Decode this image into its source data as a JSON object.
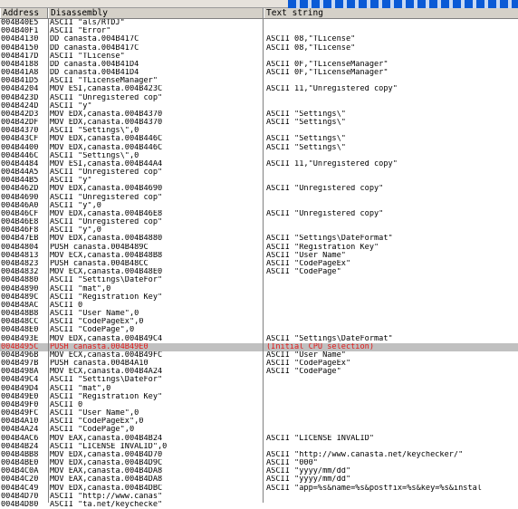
{
  "columns": {
    "address": "Address",
    "disassembly": "Disassembly",
    "text": "Text string"
  },
  "rows": [
    {
      "address": "004B40E5",
      "disasm": "ASCII \"als/RTDJ\"",
      "text": ""
    },
    {
      "address": "004B40F1",
      "disasm": "ASCII \"Error\"",
      "text": ""
    },
    {
      "address": "004B4130",
      "disasm": "DD canasta.004B417C",
      "text": "ASCII 08,\"TLicense\""
    },
    {
      "address": "004B4150",
      "disasm": "DD canasta.004B417C",
      "text": "ASCII 08,\"TLicense\""
    },
    {
      "address": "004B417D",
      "disasm": "ASCII \"TLicense\"",
      "text": ""
    },
    {
      "address": "004B4188",
      "disasm": "DD canasta.004B41D4",
      "text": "ASCII 0F,\"TLicenseManager\""
    },
    {
      "address": "004B41A8",
      "disasm": "DD canasta.004B41D4",
      "text": "ASCII 0F,\"TLicenseManager\""
    },
    {
      "address": "004B41D5",
      "disasm": "ASCII \"TLicenseManager\"",
      "text": ""
    },
    {
      "address": "004B4204",
      "disasm": "MOV ESI,canasta.004B423C",
      "text": "ASCII 11,\"Unregistered copy\""
    },
    {
      "address": "004B423D",
      "disasm": "ASCII \"Unregistered cop\"",
      "text": ""
    },
    {
      "address": "004B424D",
      "disasm": "ASCII \"y\"",
      "text": ""
    },
    {
      "address": "004B42D3",
      "disasm": "MOV EDX,canasta.004B4370",
      "text": "ASCII \"Settings\\\""
    },
    {
      "address": "004B42DF",
      "disasm": "MOV EDX,canasta.004B4370",
      "text": "ASCII \"Settings\\\""
    },
    {
      "address": "004B4370",
      "disasm": "ASCII \"Settings\\\",0",
      "text": ""
    },
    {
      "address": "004B43CF",
      "disasm": "MOV EDX,canasta.004B446C",
      "text": "ASCII \"Settings\\\""
    },
    {
      "address": "004B4400",
      "disasm": "MOV EDX,canasta.004B446C",
      "text": "ASCII \"Settings\\\""
    },
    {
      "address": "004B446C",
      "disasm": "ASCII \"Settings\\\",0",
      "text": ""
    },
    {
      "address": "004B4484",
      "disasm": "MOV ESI,canasta.004B44A4",
      "text": "ASCII 11,\"Unregistered copy\""
    },
    {
      "address": "004B44A5",
      "disasm": "ASCII \"Unregistered cop\"",
      "text": ""
    },
    {
      "address": "004B44B5",
      "disasm": "ASCII \"y\"",
      "text": ""
    },
    {
      "address": "004B462D",
      "disasm": "MOV EDX,canasta.004B4690",
      "text": "ASCII \"Unregistered copy\""
    },
    {
      "address": "004B4690",
      "disasm": "ASCII \"Unregistered cop\"",
      "text": ""
    },
    {
      "address": "004B46A0",
      "disasm": "ASCII \"y\",0",
      "text": ""
    },
    {
      "address": "004B46CF",
      "disasm": "MOV EDX,canasta.004B46E8",
      "text": "ASCII \"Unregistered copy\""
    },
    {
      "address": "004B46E8",
      "disasm": "ASCII \"Unregistered cop\"",
      "text": ""
    },
    {
      "address": "004B46F8",
      "disasm": "ASCII \"y\",0",
      "text": ""
    },
    {
      "address": "004B47EB",
      "disasm": "MOV EDX,canasta.004B4880",
      "text": "ASCII \"Settings\\DateFormat\""
    },
    {
      "address": "004B4804",
      "disasm": "PUSH canasta.004B489C",
      "text": "ASCII \"Registration Key\""
    },
    {
      "address": "004B4813",
      "disasm": "MOV ECX,canasta.004B48B8",
      "text": "ASCII \"User Name\""
    },
    {
      "address": "004B4823",
      "disasm": "PUSH canasta.004B48CC",
      "text": "ASCII \"CodePageEx\""
    },
    {
      "address": "004B4832",
      "disasm": "MOV ECX,canasta.004B48E0",
      "text": "ASCII \"CodePage\""
    },
    {
      "address": "004B4880",
      "disasm": "ASCII \"Settings\\DateFor\"",
      "text": ""
    },
    {
      "address": "004B4890",
      "disasm": "ASCII \"mat\",0",
      "text": ""
    },
    {
      "address": "004B489C",
      "disasm": "ASCII \"Registration Key\"",
      "text": ""
    },
    {
      "address": "004B48AC",
      "disasm": "ASCII 0",
      "text": ""
    },
    {
      "address": "004B48B8",
      "disasm": "ASCII \"User Name\",0",
      "text": ""
    },
    {
      "address": "004B48CC",
      "disasm": "ASCII \"CodePageEx\",0",
      "text": ""
    },
    {
      "address": "004B48E0",
      "disasm": "ASCII \"CodePage\",0",
      "text": ""
    },
    {
      "address": "004B493E",
      "disasm": "MOV EDX,canasta.004B49C4",
      "text": "ASCII \"Settings\\DateFormat\""
    },
    {
      "address": "004B495C",
      "disasm": "PUSH canasta.004B49E0",
      "text": "(Initial CPU selection)",
      "selected": true
    },
    {
      "address": "004B496B",
      "disasm": "MOV ECX,canasta.004B49FC",
      "text": "ASCII \"User Name\""
    },
    {
      "address": "004B497B",
      "disasm": "PUSH canasta.004B4A10",
      "text": "ASCII \"CodePageEx\""
    },
    {
      "address": "004B498A",
      "disasm": "MOV ECX,canasta.004B4A24",
      "text": "ASCII \"CodePage\""
    },
    {
      "address": "004B49C4",
      "disasm": "ASCII \"Settings\\DateFor\"",
      "text": ""
    },
    {
      "address": "004B49D4",
      "disasm": "ASCII \"mat\",0",
      "text": ""
    },
    {
      "address": "004B49E0",
      "disasm": "ASCII \"Registration Key\"",
      "text": ""
    },
    {
      "address": "004B49F0",
      "disasm": "ASCII 0",
      "text": ""
    },
    {
      "address": "004B49FC",
      "disasm": "ASCII \"User Name\",0",
      "text": ""
    },
    {
      "address": "004B4A10",
      "disasm": "ASCII \"CodePageEx\",0",
      "text": ""
    },
    {
      "address": "004B4A24",
      "disasm": "ASCII \"CodePage\",0",
      "text": ""
    },
    {
      "address": "004B4AC6",
      "disasm": "MOV EAX,canasta.004B4B24",
      "text": "ASCII \"LICENSE INVALID\""
    },
    {
      "address": "004B4B24",
      "disasm": "ASCII \"LICENSE INVALID\",0",
      "text": ""
    },
    {
      "address": "004B4BB8",
      "disasm": "MOV EDX,canasta.004B4D70",
      "text": "ASCII \"http://www.canasta.net/keychecker/\""
    },
    {
      "address": "004B4BE0",
      "disasm": "MOV EDX,canasta.004B4D9C",
      "text": "ASCII \"000\""
    },
    {
      "address": "004B4C0A",
      "disasm": "MOV EAX,canasta.004B4DA8",
      "text": "ASCII \"yyyy/mm/dd\""
    },
    {
      "address": "004B4C20",
      "disasm": "MOV EAX,canasta.004B4DA8",
      "text": "ASCII \"yyyy/mm/dd\""
    },
    {
      "address": "004B4C49",
      "disasm": "MOV EDX,canasta.004B4DBC",
      "text": "ASCII \"app=%s&name=%s&postfix=%s&key=%s&instal"
    },
    {
      "address": "004B4D70",
      "disasm": "ASCII \"http://www.canas\"",
      "text": ""
    },
    {
      "address": "004B4D80",
      "disasm": "ASCII \"ta.net/keychecke\"",
      "text": ""
    }
  ]
}
